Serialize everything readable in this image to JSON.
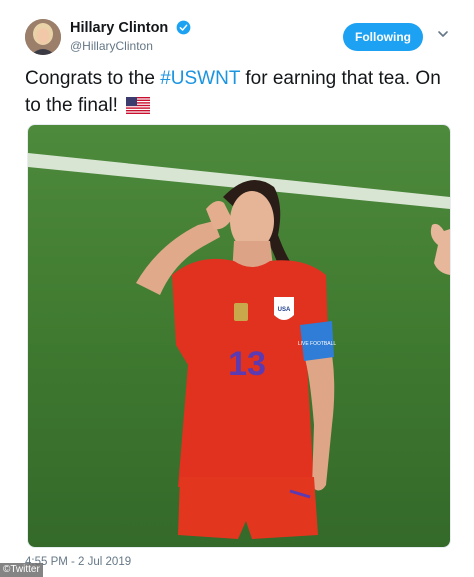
{
  "author": {
    "display_name": "Hillary Clinton",
    "handle": "@HillaryClinton",
    "verified": true
  },
  "follow_button": {
    "label": "Following",
    "color": "#1da1f2"
  },
  "tweet": {
    "text_before": "Congrats to the ",
    "hashtag": "#USWNT",
    "text_after": " for earning that tea. On to the final!",
    "emoji": "us-flag-icon",
    "hashtag_color": "#1b95e0"
  },
  "photo": {
    "jersey_number": "13",
    "crest_text": "USA",
    "armband_text": "LIVE FOOTBALL"
  },
  "timestamp": "4:55 PM - 2 Jul 2019",
  "source_badge": "©Twitter"
}
